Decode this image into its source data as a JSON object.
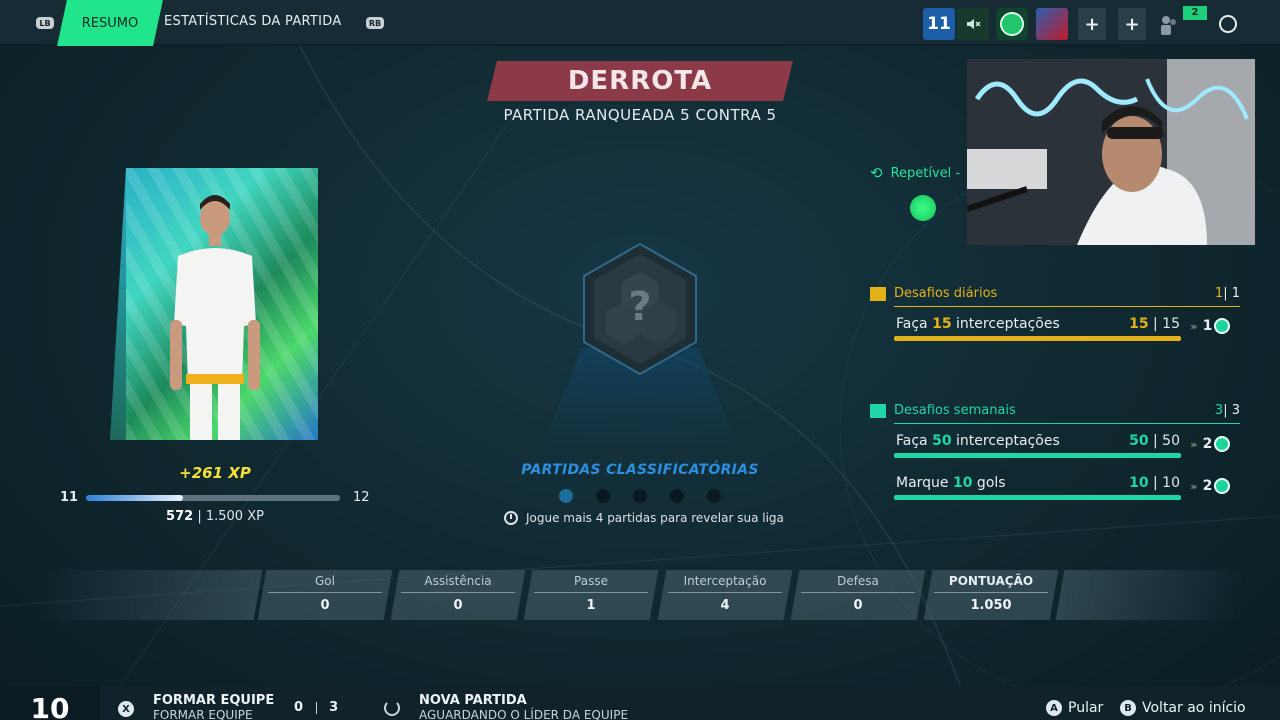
{
  "topbar": {
    "lb": "LB",
    "rb": "RB",
    "tabs": [
      "RESUMO",
      "ESTATÍSTICAS DA PARTIDA"
    ],
    "level_badge": "11",
    "notif_count": "2"
  },
  "header": {
    "result": "DERROTA",
    "mode": "PARTIDA RANQUEADA 5 CONTRA 5"
  },
  "player": {
    "xp_gain": "+261 XP",
    "level_current": "11",
    "level_next": "12",
    "xp_current": "572",
    "xp_total": "| 1.500 XP",
    "xp_progress": 0.38
  },
  "league": {
    "hex_glyph": "?",
    "title": "PARTIDAS CLASSIFICATÓRIAS",
    "matches_played": 1,
    "matches_total": 5,
    "reveal_text": "Jogue mais 4 partidas para revelar sua liga"
  },
  "repeatable": {
    "label": "Repetível - "
  },
  "daily": {
    "title": "Desafios diários",
    "count_done": "1",
    "count_total": "| 1",
    "color": "#e3b21a",
    "items": [
      {
        "pre": "Faça ",
        "num": "15",
        "post": " interceptações",
        "prog": "15",
        "total": "| 15",
        "reward": "1",
        "progress": 1.0
      }
    ]
  },
  "weekly": {
    "title": "Desafios semanais",
    "count_done": "3",
    "count_total": "| 3",
    "color": "#1fd6a8",
    "items": [
      {
        "pre": "Faça ",
        "num": "50",
        "post": " interceptações",
        "prog": "50",
        "total": "| 50",
        "reward": "2",
        "progress": 1.0
      },
      {
        "pre": "Marque ",
        "num": "10",
        "post": " gols",
        "prog": "10",
        "total": "| 10",
        "reward": "2",
        "progress": 1.0
      }
    ]
  },
  "stats": [
    {
      "label": "Gol",
      "value": "0"
    },
    {
      "label": "Assistência",
      "value": "0"
    },
    {
      "label": "Passe",
      "value": "1"
    },
    {
      "label": "Interceptação",
      "value": "4"
    },
    {
      "label": "Defesa",
      "value": "0"
    },
    {
      "label": "PONTUAÇÃO",
      "value": "1.050"
    }
  ],
  "footer": {
    "level": "10",
    "x_button": "X",
    "team_title": "FORMAR EQUIPE",
    "team_sub": "FORMAR EQUIPE",
    "team_count": "0",
    "team_max": "3",
    "match_title": "NOVA PARTIDA",
    "match_sub": "AGUARDANDO O LÍDER DA EQUIPE",
    "a_button": "A",
    "skip": "Pular",
    "b_button": "B",
    "back": "Voltar ao início"
  },
  "colors": {
    "accent": "#20e58a",
    "defeat": "#8c3a48",
    "league": "#2a8fe0",
    "xp": "#f5e03a"
  }
}
